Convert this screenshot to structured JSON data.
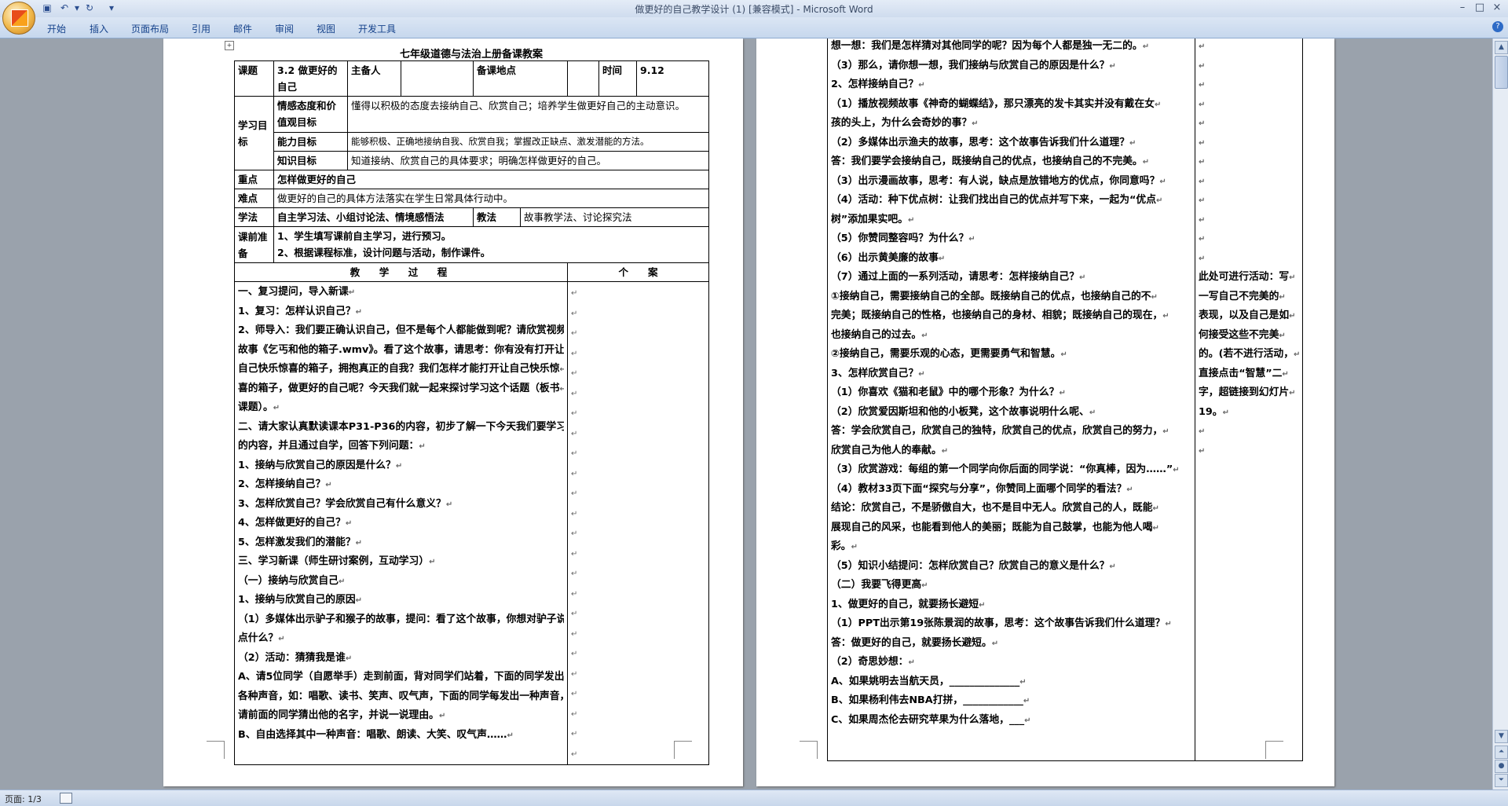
{
  "window": {
    "title": "做更好的自己教学设计 (1) [兼容模式] - Microsoft Word",
    "controls": [
      "–",
      "□",
      "×"
    ]
  },
  "quick_access": [
    "save-icon",
    "undo-icon",
    "redo-icon",
    "customize-icon"
  ],
  "ribbon_tabs": [
    "开始",
    "插入",
    "页面布局",
    "引用",
    "邮件",
    "审阅",
    "视图",
    "开发工具"
  ],
  "status_bar": {
    "page_info": "页面: 1/3"
  },
  "doc": {
    "title": "七年级道德与法治上册备课教案",
    "header": {
      "lesson_label": "课题",
      "lesson": "3.2 做更好的自己",
      "preparer_label": "主备人",
      "preparer": "",
      "place_label": "备课地点",
      "place": "",
      "time_label": "时间",
      "time": "9.12"
    },
    "goals_label": "学习目标",
    "goals": [
      {
        "label": "情感态度和价值观目标",
        "text": "懂得以积极的态度去接纳自己、欣赏自己；培养学生做更好自己的主动意识。"
      },
      {
        "label": "能力目标",
        "text": "能够积极、正确地接纳自我、欣赏自我；掌握改正缺点、激发潜能的方法。"
      },
      {
        "label": "知识目标",
        "text": "知道接纳、欣赏自己的具体要求；明确怎样做更好的自己。"
      }
    ],
    "key_label": "重点",
    "key_point": "怎样做更好的自己",
    "difficulty_label": "难点",
    "difficulty": "做更好的自己的具体方法落实在学生日常具体行动中。",
    "study_method_label": "学法",
    "study_method": "自主学习法、小组讨论法、情境感悟法",
    "teach_method_label": "教法",
    "teach_method": "故事教学法、讨论探究法",
    "prep_label": "课前准备",
    "prep": [
      "1、学生填写课前自主学习，进行预习。",
      "2、根据课程标准，设计问题与活动，制作课件。"
    ],
    "process_header": "教　学　过　程",
    "notes_header": "个　　案",
    "process_p1": [
      "一、复习提问，导入新课",
      "1、复习：怎样认识自己？",
      "2、师导入：我们要正确认识自己，但不是每个人都能做到呢？请欣赏视频",
      "故事《乞丐和他的箱子.wmv》。看了这个故事，请思考：你有没有打开让",
      "自己快乐惊喜的箱子，拥抱真正的自我？我们怎样才能打开让自己快乐惊",
      "喜的箱子，做更好的自己呢？今天我们就一起来探讨学习这个话题（板书",
      "课题）。",
      "二、请大家认真默读课本P31-P36的内容，初步了解一下今天我们要学习",
      "的内容，并且通过自学，回答下列问题：",
      "1、接纳与欣赏自己的原因是什么？",
      "2、怎样接纳自己？",
      "3、怎样欣赏自己？学会欣赏自己有什么意义？",
      "4、怎样做更好的自己？",
      "5、怎样激发我们的潜能？",
      "三、学习新课（师生研讨案例，互动学习）",
      "（一）接纳与欣赏自己",
      "1、接纳与欣赏自己的原因",
      "（1）多媒体出示驴子和猴子的故事，提问：看了这个故事，你想对驴子说",
      "点什么？",
      "（2）活动：猜猜我是谁",
      "A、请5位同学（自愿举手）走到前面，背对同学们站着，下面的同学发出",
      "各种声音，如：唱歌、读书、笑声、叹气声，下面的同学每发出一种声音，",
      "请前面的同学猜出他的名字，并说一说理由。",
      "B、自由选择其中一种声音：唱歌、朗读、大笑、叹气声……"
    ],
    "process_p2": [
      "想一想：我们是怎样猜对其他同学的呢？因为每个人都是独一无二的。",
      "（3）那么，请你想一想，我们接纳与欣赏自己的原因是什么？",
      "2、怎样接纳自己？",
      "（1）播放视频故事《神奇的蝴蝶结》，那只漂亮的发卡其实并没有戴在女",
      "孩的头上，为什么会奇妙的事？",
      "（2）多媒体出示渔夫的故事，思考：这个故事告诉我们什么道理？",
      "答：我们要学会接纳自己，既接纳自己的优点，也接纳自己的不完美。",
      "（3）出示漫画故事，思考：有人说，缺点是放错地方的优点，你同意吗？",
      "（4）活动：种下优点树：让我们找出自己的优点并写下来，一起为“优点",
      "树”添加果实吧。",
      "（5）你赞同整容吗？为什么？",
      "（6）出示黄美廉的故事",
      "（7）通过上面的一系列活动，请思考：怎样接纳自己？",
      "①接纳自己，需要接纳自己的全部。既接纳自己的优点，也接纳自己的不",
      "完美；既接纳自己的性格，也接纳自己的身材、相貌；既接纳自己的现在，",
      "也接纳自己的过去。",
      "②接纳自己，需要乐观的心态，更需要勇气和智慧。",
      "3、怎样欣赏自己？",
      "（1）你喜欢《猫和老鼠》中的哪个形象？为什么？",
      "（2）欣赏爱因斯坦和他的小板凳，这个故事说明什么呢、",
      "答：学会欣赏自己，欣赏自己的独特，欣赏自己的优点，欣赏自己的努力，",
      "欣赏自己为他人的奉献。",
      "（3）欣赏游戏：每组的第一个同学向你后面的同学说：“你真棒，因为……”",
      "（4）教材33页下面“探究与分享”，你赞同上面哪个同学的看法？",
      "结论：欣赏自己，不是骄傲自大，也不是目中无人。欣赏自己的人，既能",
      "展现自己的风采，也能看到他人的美丽；既能为自己鼓掌，也能为他人喝",
      "彩。",
      "（5）知识小结提问：怎样欣赏自己？欣赏自己的意义是什么？",
      "（二）我要飞得更高",
      "1、做更好的自己，就要扬长避短",
      "（1）PPT出示第19张陈景润的故事，思考：这个故事告诉我们什么道理？",
      "答：做更好的自己，就要扬长避短。",
      "（2）奇思妙想：",
      "A、如果姚明去当航天员，______________",
      "B、如果杨利伟去NBA打拼，____________",
      "C、如果周杰伦去研究苹果为什么落地，___"
    ],
    "notes_p2": [
      "",
      "",
      "",
      "",
      "",
      "",
      "",
      "",
      "",
      "",
      "",
      "",
      "此处可进行活动：写",
      "一写自己不完美的",
      "表现，以及自己是如",
      "何接受这些不完美",
      "的。(若不进行活动，",
      "直接点击“智慧”二",
      "字，超链接到幻灯片",
      "19。",
      "",
      ""
    ]
  }
}
